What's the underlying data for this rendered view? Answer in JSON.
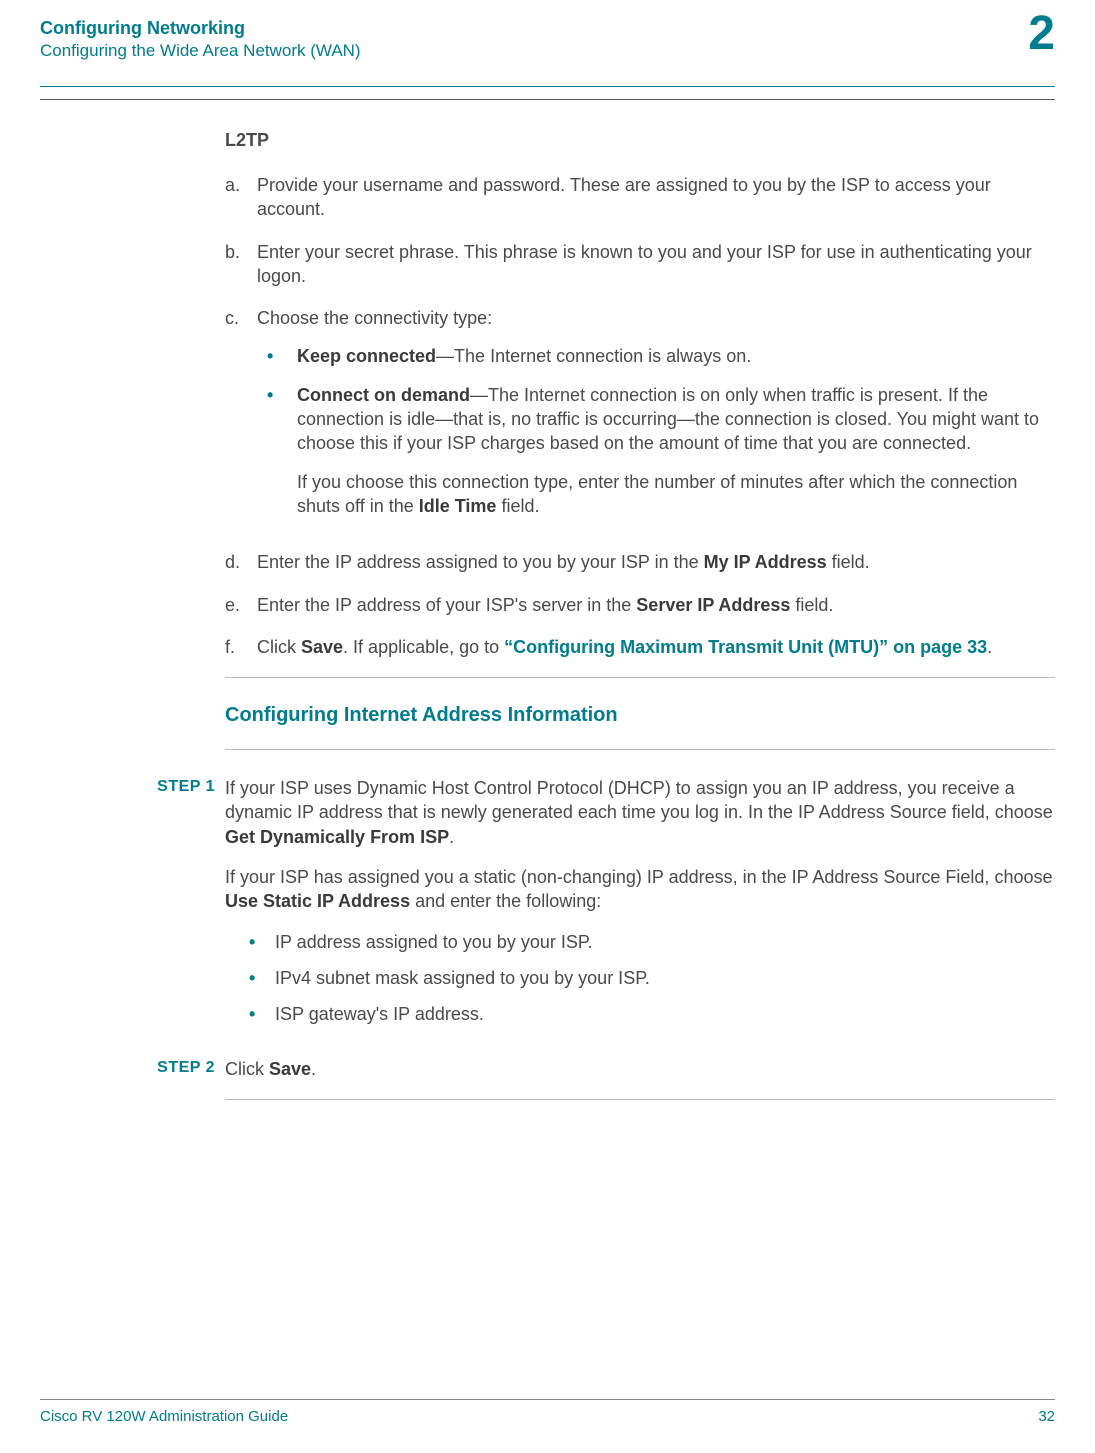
{
  "header": {
    "title": "Configuring Networking",
    "subtitle": "Configuring the Wide Area Network (WAN)",
    "chapter": "2"
  },
  "l2tp": {
    "title": "L2TP",
    "items": {
      "a": {
        "marker": "a.",
        "text": "Provide your username and password. These are assigned to you by the ISP to access your account."
      },
      "b": {
        "marker": "b.",
        "text": "Enter your secret phrase. This phrase is known to you and your ISP for use in authenticating your logon."
      },
      "c": {
        "marker": "c.",
        "text": "Choose the connectivity type:",
        "bullets": {
          "keep": {
            "bold": "Keep connected",
            "rest": "—The Internet connection is always on."
          },
          "demand": {
            "bold": "Connect on demand",
            "rest": "—The Internet connection is on only when traffic is present. If the connection is idle—that is, no traffic is occurring—the connection is closed. You might want to choose this if your ISP charges based on the amount of time that you are connected.",
            "extra_pre": "If you choose this connection type, enter the number of minutes after which the connection shuts off in the ",
            "extra_bold": "Idle Time",
            "extra_post": " field."
          }
        }
      },
      "d": {
        "marker": "d.",
        "pre": "Enter the IP address assigned to you by your ISP in the ",
        "bold": "My IP Address",
        "post": " field."
      },
      "e": {
        "marker": "e.",
        "pre": "Enter the IP address of your ISP's server in the ",
        "bold": "Server IP Address",
        "post": " field."
      },
      "f": {
        "marker": "f.",
        "pre": "Click ",
        "bold": "Save",
        "mid": ". If applicable, go to ",
        "link": "“Configuring Maximum Transmit Unit (MTU)” on page 33",
        "post": "."
      }
    }
  },
  "subsection": {
    "title": "Configuring Internet Address Information",
    "step1": {
      "label": "STEP  1",
      "para1_pre": "If your ISP uses Dynamic Host Control Protocol (DHCP) to assign you an IP address, you receive a dynamic IP address that is newly generated each time you log in. In the IP Address Source field, choose ",
      "para1_bold": "Get Dynamically From ISP",
      "para1_post": ".",
      "para2_pre": "If your ISP has assigned you a static (non-changing) IP address, in the IP Address Source Field, choose ",
      "para2_bold": "Use Static IP Address",
      "para2_post": " and enter the following:",
      "bullets": {
        "b1": "IP address assigned to you by your ISP.",
        "b2": "IPv4 subnet mask assigned to you by your ISP.",
        "b3": "ISP gateway's IP address."
      }
    },
    "step2": {
      "label": "STEP  2",
      "pre": "Click ",
      "bold": "Save",
      "post": "."
    }
  },
  "footer": {
    "left": "Cisco RV 120W Administration Guide",
    "right": "32"
  },
  "bullet_glyph": "•"
}
